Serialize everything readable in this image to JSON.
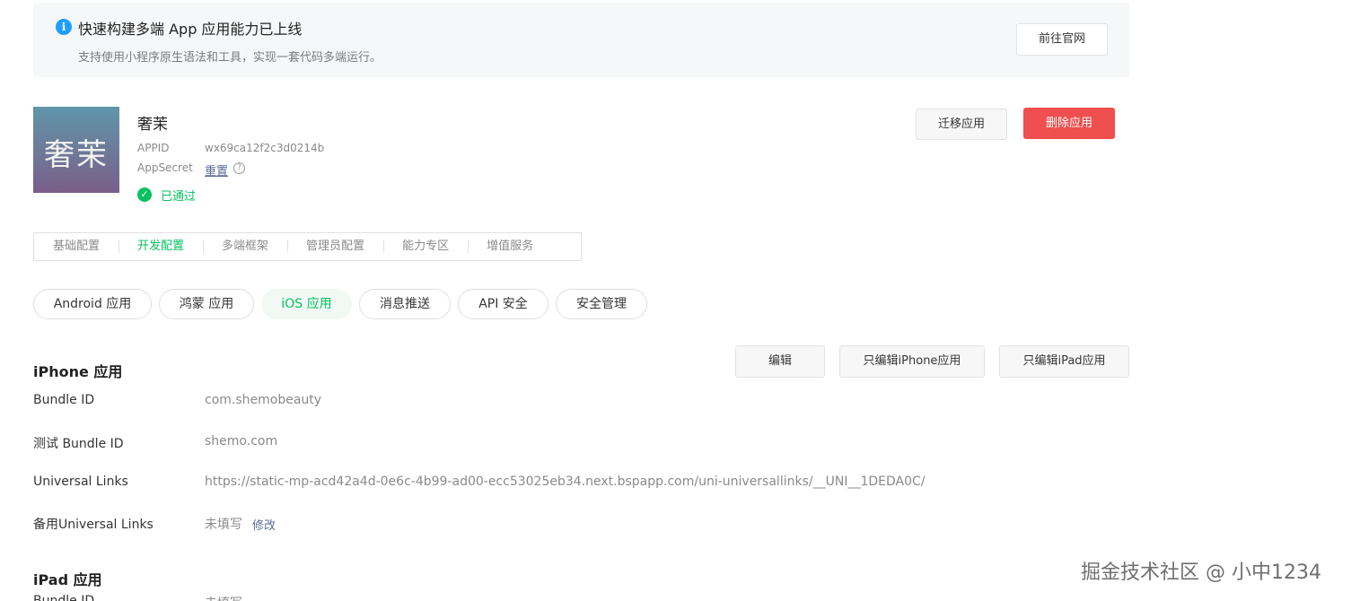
{
  "banner": {
    "title": "快速构建多端 App 应用能力已上线",
    "description": "支持使用小程序原生语法和工具，实现一套代码多端运行。",
    "goto_button": "前往官网"
  },
  "app": {
    "avatar_text": "奢茉",
    "name": "奢茉",
    "appid_label": "APPID",
    "appid_value": "wx69ca12f2c3d0214b",
    "appsecret_label": "AppSecret",
    "reset_link": "重置",
    "help_glyph": "?",
    "status_text": "已通过",
    "migrate_button": "迁移应用",
    "delete_button": "删除应用"
  },
  "main_tabs": [
    {
      "label": "基础配置"
    },
    {
      "label": "开发配置",
      "active": true
    },
    {
      "label": "多端框架"
    },
    {
      "label": "管理员配置"
    },
    {
      "label": "能力专区"
    },
    {
      "label": "增值服务"
    }
  ],
  "sub_tabs": [
    {
      "label": "Android 应用"
    },
    {
      "label": "鸿蒙 应用"
    },
    {
      "label": "iOS 应用",
      "active": true
    },
    {
      "label": "消息推送"
    },
    {
      "label": "API 安全"
    },
    {
      "label": "安全管理"
    }
  ],
  "iphone_section": {
    "title": "iPhone 应用",
    "edit_button": "编辑",
    "edit_iphone_button": "只编辑iPhone应用",
    "edit_ipad_button": "只编辑iPad应用",
    "rows": [
      {
        "label": "Bundle ID",
        "value": "com.shemobeauty"
      },
      {
        "label": "测试 Bundle ID",
        "value": "shemo.com"
      },
      {
        "label": "Universal Links",
        "value": "https://static-mp-acd42a4d-0e6c-4b99-ad00-ecc53025eb34.next.bspapp.com/uni-universallinks/__UNI__1DEDA0C/"
      },
      {
        "label": "备用Universal Links",
        "value": "未填写",
        "link": "修改"
      }
    ]
  },
  "ipad_section": {
    "title": "iPad 应用",
    "rows": [
      {
        "label": "Bundle ID",
        "value": "未填写"
      }
    ]
  },
  "watermark": "掘金技术社区 @ 小中1234",
  "colors": {
    "accent_green": "#07c160",
    "danger_red": "#ef4f4f",
    "link_blue": "#576b95",
    "info_blue": "#1e9fff"
  }
}
